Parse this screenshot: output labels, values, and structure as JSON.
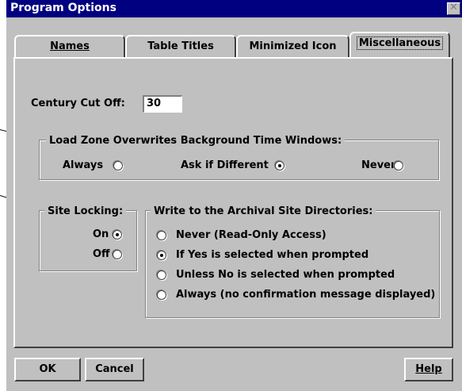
{
  "window": {
    "title": "Program Options",
    "close_glyph": "✕"
  },
  "tabs": [
    {
      "label": "Names",
      "hotkey_index": 0
    },
    {
      "label": "Table Titles",
      "hotkey_index": 0
    },
    {
      "label": "Minimized Icon",
      "hotkey_index": 10
    },
    {
      "label": "Miscellaneous",
      "hotkey_index": 0,
      "active": true
    }
  ],
  "century": {
    "label": "Century Cut Off:",
    "value": "30"
  },
  "load_zone": {
    "title": "Load Zone Overwrites Background Time Windows:",
    "options": [
      {
        "label": "Always",
        "selected": false
      },
      {
        "label": "Ask if Different",
        "selected": true
      },
      {
        "label": "Never",
        "selected": false
      }
    ]
  },
  "site_locking": {
    "title": "Site Locking:",
    "options": [
      {
        "label": "On",
        "selected": true
      },
      {
        "label": "Off",
        "selected": false
      }
    ]
  },
  "archival": {
    "title": "Write to the Archival Site Directories:",
    "options": [
      {
        "label": "Never (Read-Only Access)",
        "selected": false
      },
      {
        "label": "If Yes is selected when prompted",
        "selected": true
      },
      {
        "label": "Unless No is selected when prompted",
        "selected": false
      },
      {
        "label": "Always (no confirmation message displayed)",
        "selected": false
      }
    ]
  },
  "buttons": {
    "ok": "OK",
    "cancel": "Cancel",
    "help": "Help"
  },
  "colors": {
    "face": "#c0c0c0",
    "titlebar": "#000080",
    "shadow": "#808080",
    "highlight": "#ffffff"
  }
}
